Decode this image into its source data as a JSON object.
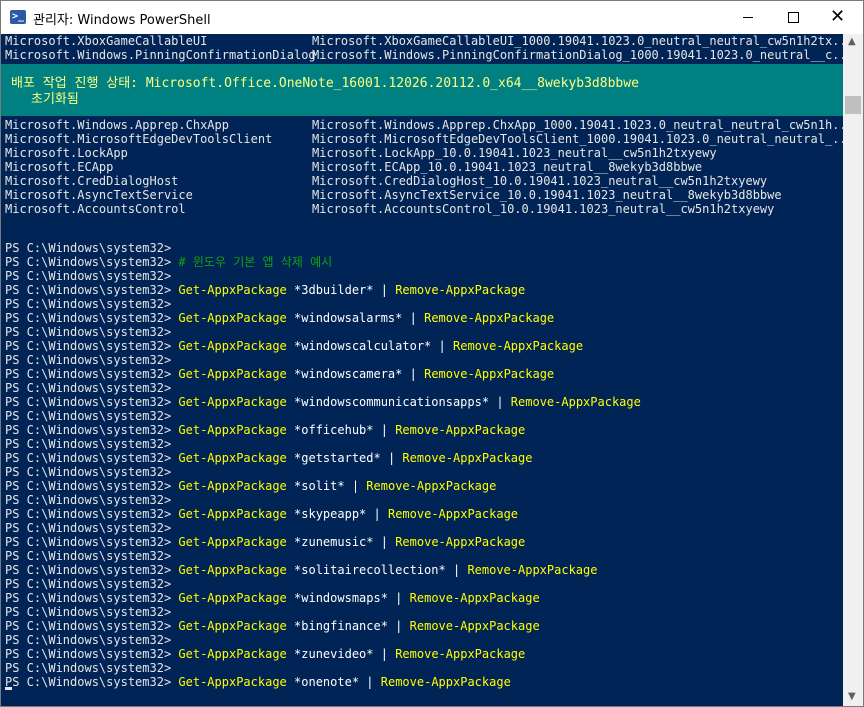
{
  "window": {
    "title": "관리자: Windows PowerShell",
    "icon_text": ">_",
    "minimize_label": "",
    "close_label": "✕"
  },
  "colors": {
    "console_bg": "#012456",
    "progress_bg": "#008080",
    "command": "#ffff00",
    "comment": "#13a10e"
  },
  "progress": {
    "title": "배포 작업 진행 상태: Microsoft.Office.OneNote_16001.12026.20112.0_x64__8wekyb3d8bbwe",
    "status": "초기화됨"
  },
  "packages_above": [
    {
      "name": "Microsoft.XboxGameCallableUI",
      "full": "Microsoft.XboxGameCallableUI_1000.19041.1023.0_neutral_neutral_cw5n1h2tx..."
    },
    {
      "name": "Microsoft.Windows.PinningConfirmationDialog",
      "full": "Microsoft.Windows.PinningConfirmationDialog_1000.19041.1023.0_neutral__c..."
    }
  ],
  "packages_below": [
    {
      "name": "Microsoft.Windows.Apprep.ChxApp",
      "full": "Microsoft.Windows.Apprep.ChxApp_1000.19041.1023.0_neutral_neutral_cw5n1h..."
    },
    {
      "name": "Microsoft.MicrosoftEdgeDevToolsClient",
      "full": "Microsoft.MicrosoftEdgeDevToolsClient_1000.19041.1023.0_neutral_neutral_..."
    },
    {
      "name": "Microsoft.LockApp",
      "full": "Microsoft.LockApp_10.0.19041.1023_neutral__cw5n1h2txyewy"
    },
    {
      "name": "Microsoft.ECApp",
      "full": "Microsoft.ECApp_10.0.19041.1023_neutral__8wekyb3d8bbwe"
    },
    {
      "name": "Microsoft.CredDialogHost",
      "full": "Microsoft.CredDialogHost_10.0.19041.1023_neutral__cw5n1h2txyewy"
    },
    {
      "name": "Microsoft.AsyncTextService",
      "full": "Microsoft.AsyncTextService_10.0.19041.1023_neutral__8wekyb3d8bbwe"
    },
    {
      "name": "Microsoft.AccountsControl",
      "full": "Microsoft.AccountsControl_10.0.19041.1023_neutral__cw5n1h2txyewy"
    }
  ],
  "prompt": "PS C:\\Windows\\system32>",
  "comment": "# 윈도우 기본 앱 삭제 예시",
  "get_cmd": "Get-AppxPackage",
  "pipe": "|",
  "remove_cmd": "Remove-AppxPackage",
  "commands": [
    "*3dbuilder*",
    "*windowsalarms*",
    "*windowscalculator*",
    "*windowscamera*",
    "*windowscommunicationsapps*",
    "*officehub*",
    "*getstarted*",
    "*solit*",
    "*skypeapp*",
    "*zunemusic*",
    "*solitairecollection*",
    "*windowsmaps*",
    "*bingfinance*",
    "*zunevideo*",
    "*onenote*"
  ]
}
